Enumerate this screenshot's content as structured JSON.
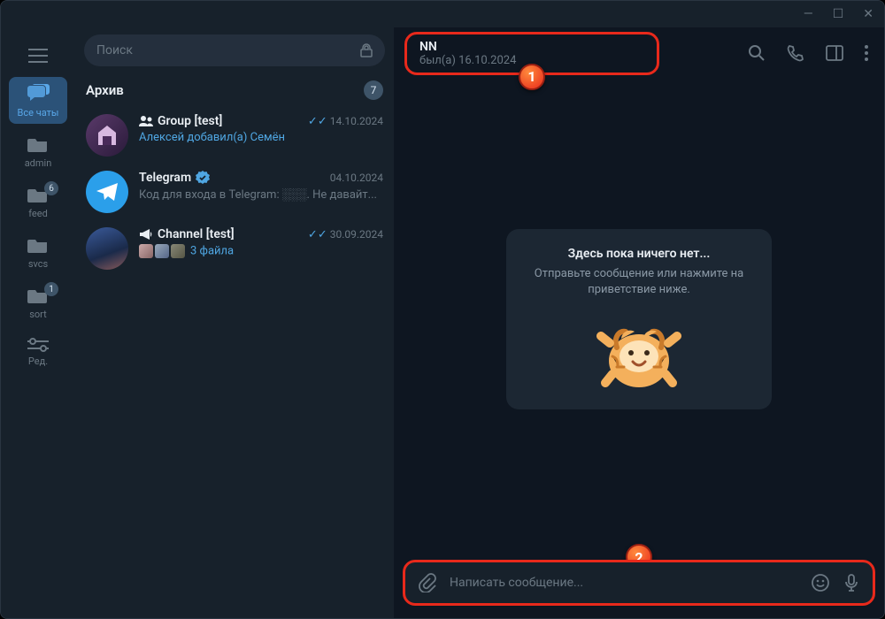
{
  "titlebar": {
    "min": "—",
    "max": "☐",
    "close": "✕"
  },
  "rail": {
    "items": [
      {
        "key": "all",
        "label": "Все чаты",
        "active": true
      },
      {
        "key": "admin",
        "label": "admin"
      },
      {
        "key": "feed",
        "label": "feed",
        "badge": "6"
      },
      {
        "key": "svcs",
        "label": "svcs"
      },
      {
        "key": "sort",
        "label": "sort",
        "badge": "1"
      },
      {
        "key": "edit",
        "label": "Ред."
      }
    ]
  },
  "search": {
    "placeholder": "Поиск"
  },
  "archive": {
    "title": "Архив",
    "count": "7"
  },
  "chats": [
    {
      "name": "Group [test]",
      "icon": "group",
      "date": "14.10.2024",
      "read": true,
      "sub": "Алексей добавил(а) Семён",
      "subLink": true,
      "avatar": "grad1"
    },
    {
      "name": "Telegram",
      "icon": "verified",
      "date": "04.10.2024",
      "read": false,
      "sub": "Код для входа в Telegram: ░░░. Не давайт...",
      "subLink": false,
      "avatar": "tg"
    },
    {
      "name": "Channel [test]",
      "icon": "channel",
      "date": "30.09.2024",
      "read": true,
      "sub": "3 файла",
      "subLink": true,
      "thumbs": true,
      "avatar": "grad2"
    }
  ],
  "header": {
    "name": "NN",
    "status": "был(а) 16.10.2024"
  },
  "empty": {
    "title": "Здесь пока ничего нет...",
    "sub": "Отправьте сообщение или нажмите на приветствие ниже."
  },
  "composer": {
    "placeholder": "Написать сообщение..."
  },
  "annotations": {
    "one": "1",
    "two": "2"
  }
}
